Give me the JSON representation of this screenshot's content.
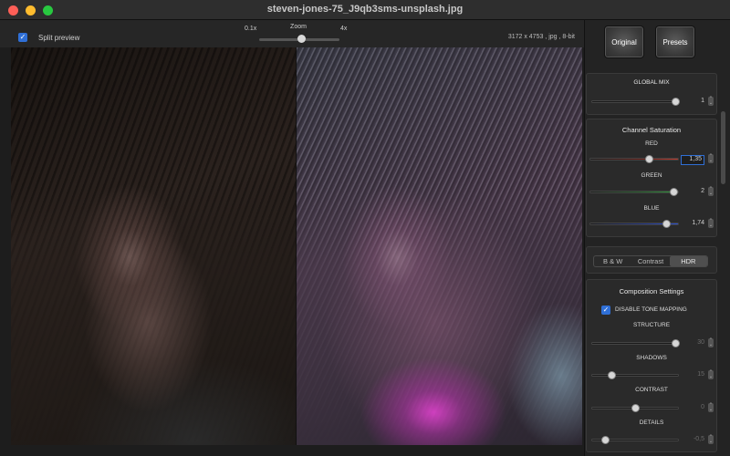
{
  "window": {
    "title": "steven-jones-75_J9qb3sms-unsplash.jpg"
  },
  "toolbar": {
    "split_label": "Split preview",
    "zoom_label": "Zoom",
    "zoom_min": "0.1x",
    "zoom_max": "4x",
    "image_info": "3172 x 4753 , jpg , 8-bit"
  },
  "buttons": {
    "original": "Original",
    "presets": "Presets"
  },
  "global_mix": {
    "title": "GLOBAL MIX",
    "value": "1"
  },
  "channel_saturation": {
    "title": "Channel Saturation",
    "red": {
      "label": "RED",
      "value": "1,35",
      "color": "#c0392b"
    },
    "green": {
      "label": "GREEN",
      "value": "2",
      "color": "#2e9b3a"
    },
    "blue": {
      "label": "BLUE",
      "value": "1,74",
      "color": "#2a4fd0"
    }
  },
  "modes": {
    "bw": "B & W",
    "contrast": "Contrast",
    "hdr": "HDR",
    "active": "HDR"
  },
  "composition": {
    "title": "Composition Settings",
    "disable_tone_mapping": "DISABLE TONE MAPPING",
    "structure": {
      "label": "STRUCTURE",
      "value": "30"
    },
    "shadows": {
      "label": "SHADOWS",
      "value": "15"
    },
    "contrast": {
      "label": "CONTRAST",
      "value": "0"
    },
    "details": {
      "label": "DETAILS",
      "value": "-0,5"
    }
  },
  "colors": {
    "accent": "#2f6fd6",
    "panel": "#2a2a2a"
  }
}
